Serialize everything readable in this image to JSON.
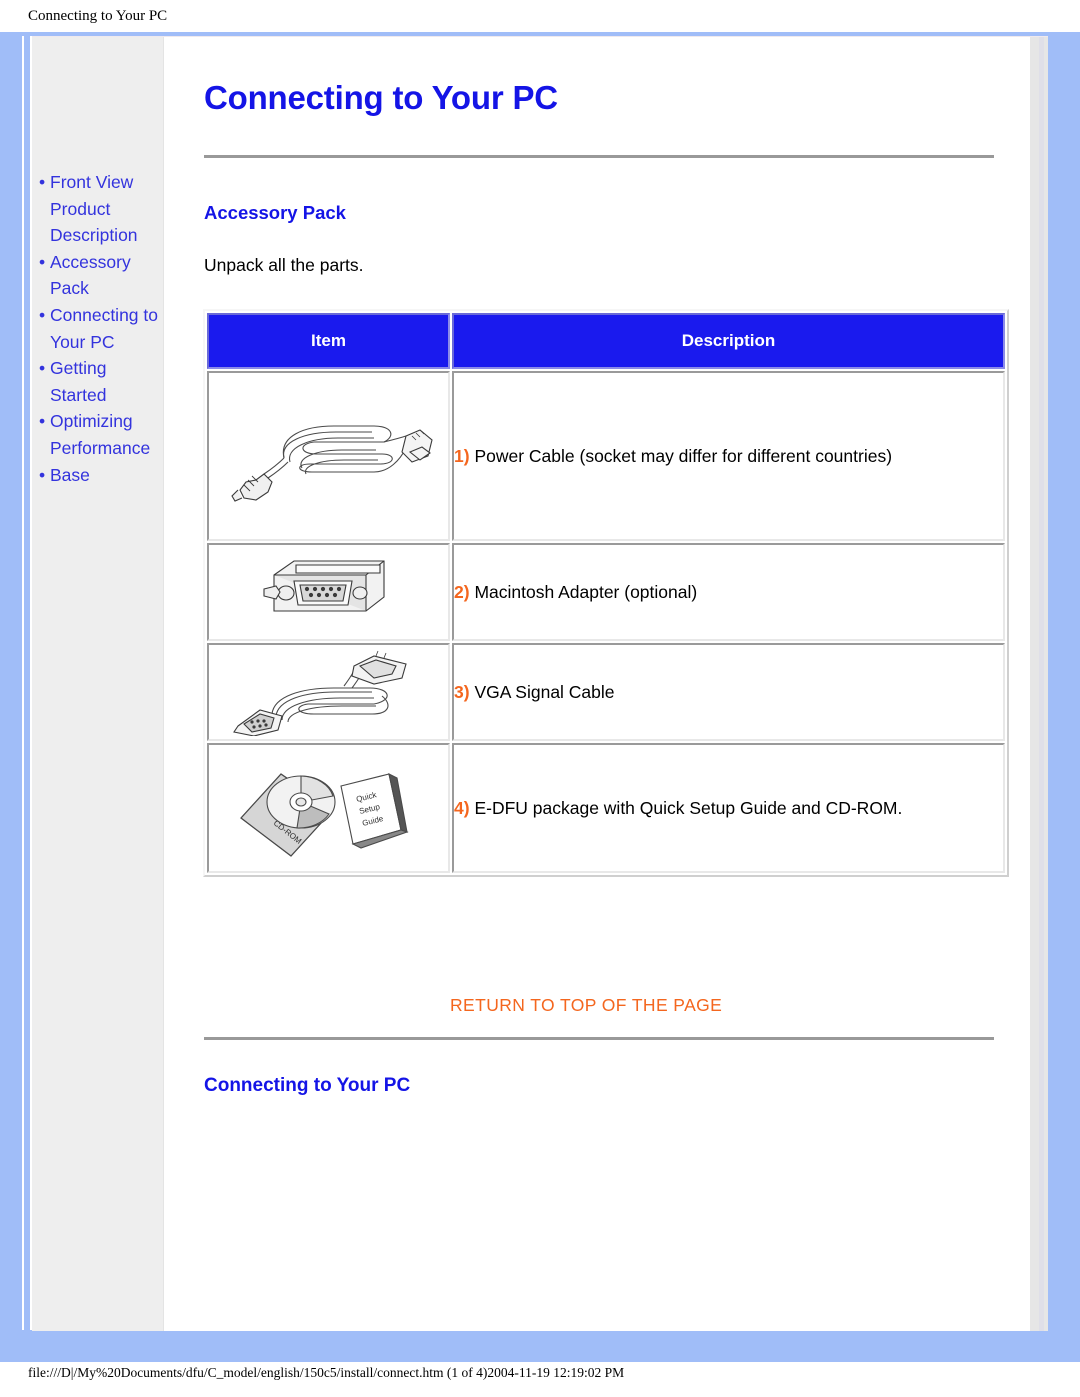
{
  "browser": {
    "header_title": "Connecting to Your PC",
    "footer_path": "file:///D|/My%20Documents/dfu/C_model/english/150c5/install/connect.htm (1 of 4)2004-11-19 12:19:02 PM"
  },
  "colors": {
    "frame_blue": "#A0BDF8",
    "link_blue": "#3333DD",
    "heading_blue": "#1414E6",
    "table_header_blue": "#1A1AEE",
    "accent_orange": "#F4661E",
    "sidebar_gray": "#EEEEEE"
  },
  "sidebar": {
    "items": [
      {
        "label": "Front View Product Description",
        "bullet": "•"
      },
      {
        "label": "Accessory Pack",
        "bullet": "•"
      },
      {
        "label": "Connecting to Your PC",
        "bullet": "•"
      },
      {
        "label": "Getting Started",
        "bullet": "•"
      },
      {
        "label": "Optimizing Performance",
        "bullet": "•"
      },
      {
        "label": "Base",
        "bullet": "•"
      }
    ]
  },
  "main": {
    "page_title": "Connecting to Your PC",
    "accessory_heading": "Accessory Pack",
    "intro_text": "Unpack all the parts.",
    "table": {
      "headers": [
        "Item",
        "Description"
      ],
      "rows": [
        {
          "number": "1)",
          "description": "Power Cable (socket may differ for different countries)",
          "icon": "power-cable-image"
        },
        {
          "number": "2)",
          "description": "Macintosh Adapter (optional)",
          "icon": "macintosh-adapter-image"
        },
        {
          "number": "3)",
          "description": "VGA Signal Cable",
          "icon": "vga-signal-cable-image"
        },
        {
          "number": "4)",
          "description": "E-DFU package with Quick Setup Guide and CD-ROM.",
          "icon": "cdrom-package-image"
        }
      ]
    },
    "return_to_top": "RETURN TO TOP OF THE PAGE",
    "connecting_heading": "Connecting to Your PC",
    "image_labels": {
      "cdrom": "CD-ROM",
      "quick_setup_guide": "Quick Setup Guide"
    }
  }
}
